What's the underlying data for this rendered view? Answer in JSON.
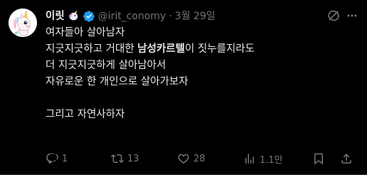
{
  "tweet": {
    "display_name": "이릿",
    "name_emoji": "unicorn-emoji",
    "verified": true,
    "handle": "@irit_conomy",
    "separator": "·",
    "timestamp": "3월 29일",
    "text_lines": [
      {
        "pre": "여자들아 살아남자",
        "bold": "",
        "post": ""
      },
      {
        "pre": "지긋지긋하고 거대한 ",
        "bold": "남성카르텔",
        "post": "이 짓누를지라도"
      },
      {
        "pre": "더 지긋지긋하게 살아남아서",
        "bold": "",
        "post": ""
      },
      {
        "pre": "자유로운 한 개인으로 살아가보자",
        "bold": "",
        "post": ""
      },
      {
        "pre": "",
        "bold": "",
        "post": ""
      },
      {
        "pre": "그리고 자연사하자",
        "bold": "",
        "post": ""
      }
    ]
  },
  "actions": {
    "reply_count": "1",
    "retweet_count": "13",
    "like_count": "28",
    "view_count": "1.1만"
  },
  "colors": {
    "background": "#000000",
    "text_primary": "#e7e9ea",
    "text_secondary": "#71767b",
    "verified_blue": "#1d9bf0",
    "divider": "#2f3336"
  },
  "icons": {
    "avatar": "unicorn-avatar",
    "verified": "verified-badge-icon",
    "grok": "grok-icon",
    "more": "more-icon",
    "reply": "reply-icon",
    "retweet": "retweet-icon",
    "like": "heart-icon",
    "views": "views-chart-icon",
    "bookmark": "bookmark-icon",
    "share": "share-icon"
  }
}
